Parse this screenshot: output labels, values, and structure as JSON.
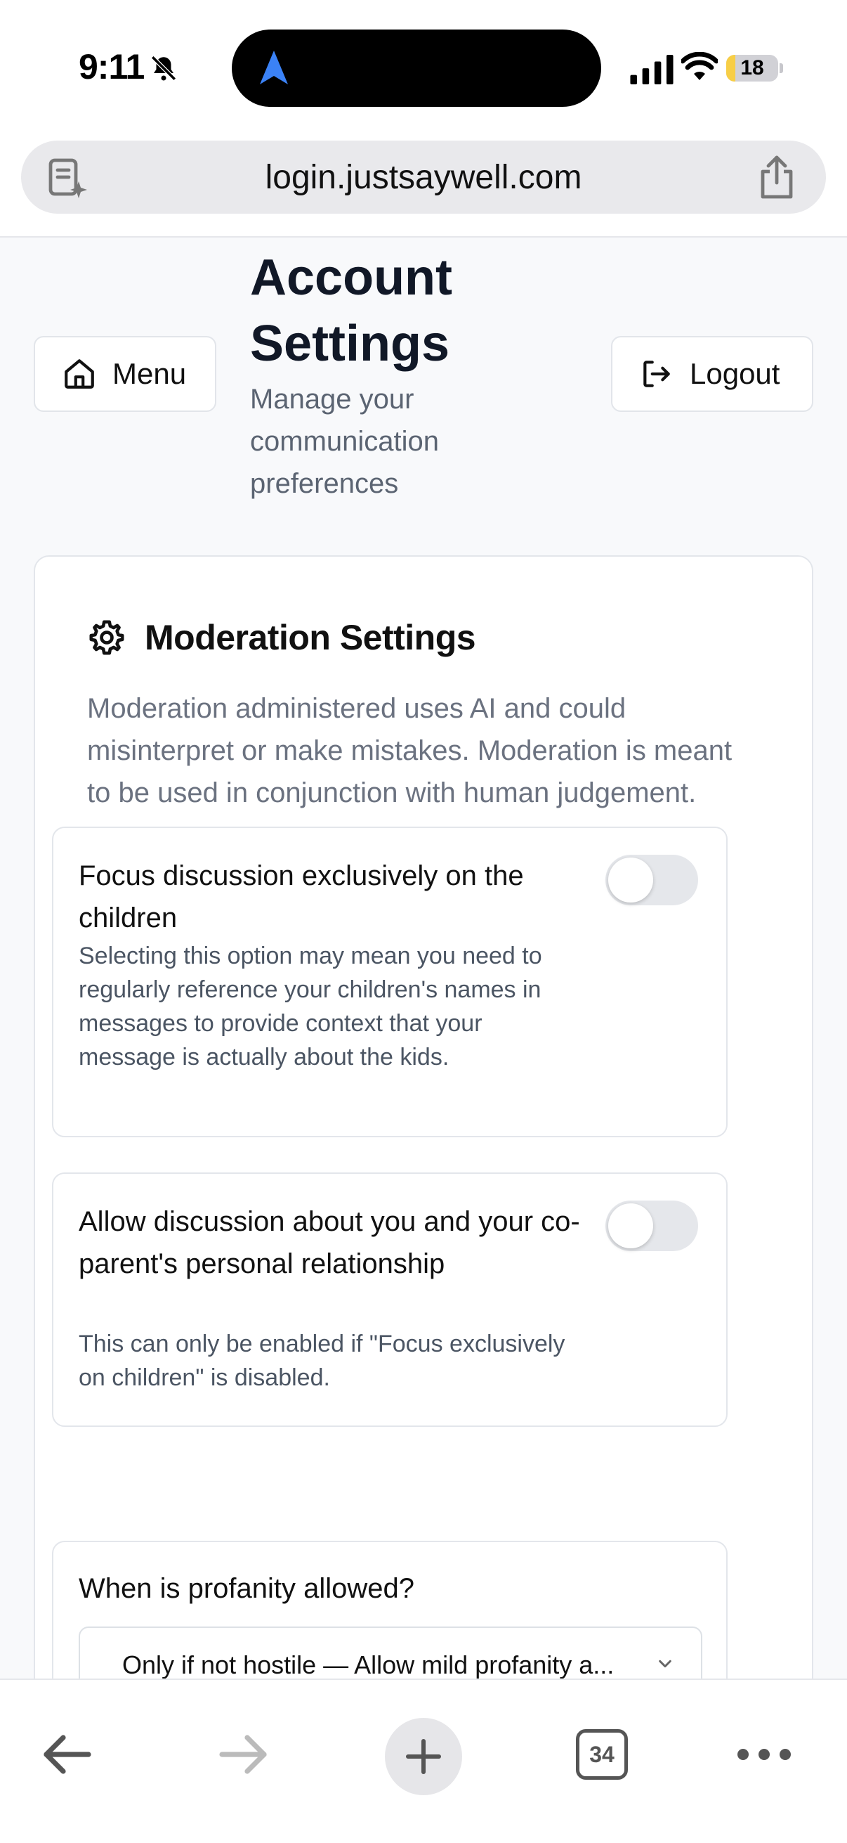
{
  "status_bar": {
    "time": "9:11",
    "battery_level": "18",
    "battery_fraction": 0.18
  },
  "browser": {
    "url": "login.justsaywell.com",
    "tab_count": "34"
  },
  "header": {
    "menu_label": "Menu",
    "logout_label": "Logout",
    "title": "Account Settings",
    "subtitle": "Manage your communication preferences"
  },
  "moderation": {
    "title": "Moderation Settings",
    "description": "Moderation administered uses AI and could misinterpret or make mistakes. Moderation is meant to be used in conjunction with human judgement.",
    "options": [
      {
        "title": "Focus discussion exclusively on the children",
        "description": "Selecting this option may mean you need to regularly reference your children's names in messages to provide context that your message is actually about the kids.",
        "enabled": false
      },
      {
        "title": "Allow discussion about you and your co-parent's personal relationship",
        "description": "This can only be enabled if \"Focus exclusively on children\" is disabled.",
        "enabled": false
      }
    ],
    "profanity": {
      "question": "When is profanity allowed?",
      "selected": "Only if not hostile — Allow mild profanity a..."
    }
  },
  "colors": {
    "accent_nav": "#3b82f6",
    "battery_low": "#f7ce46",
    "toggle_off": "#e5e7eb"
  },
  "icons": {
    "bell": "bell-slash-icon",
    "location": "location-arrow-icon",
    "reader": "reader-mode-icon",
    "share": "share-icon",
    "home": "home-icon",
    "logout": "logout-icon",
    "gear": "gear-icon",
    "back": "back-arrow-icon",
    "forward": "forward-arrow-icon",
    "new_tab": "plus-icon",
    "more": "more-dots-icon"
  }
}
